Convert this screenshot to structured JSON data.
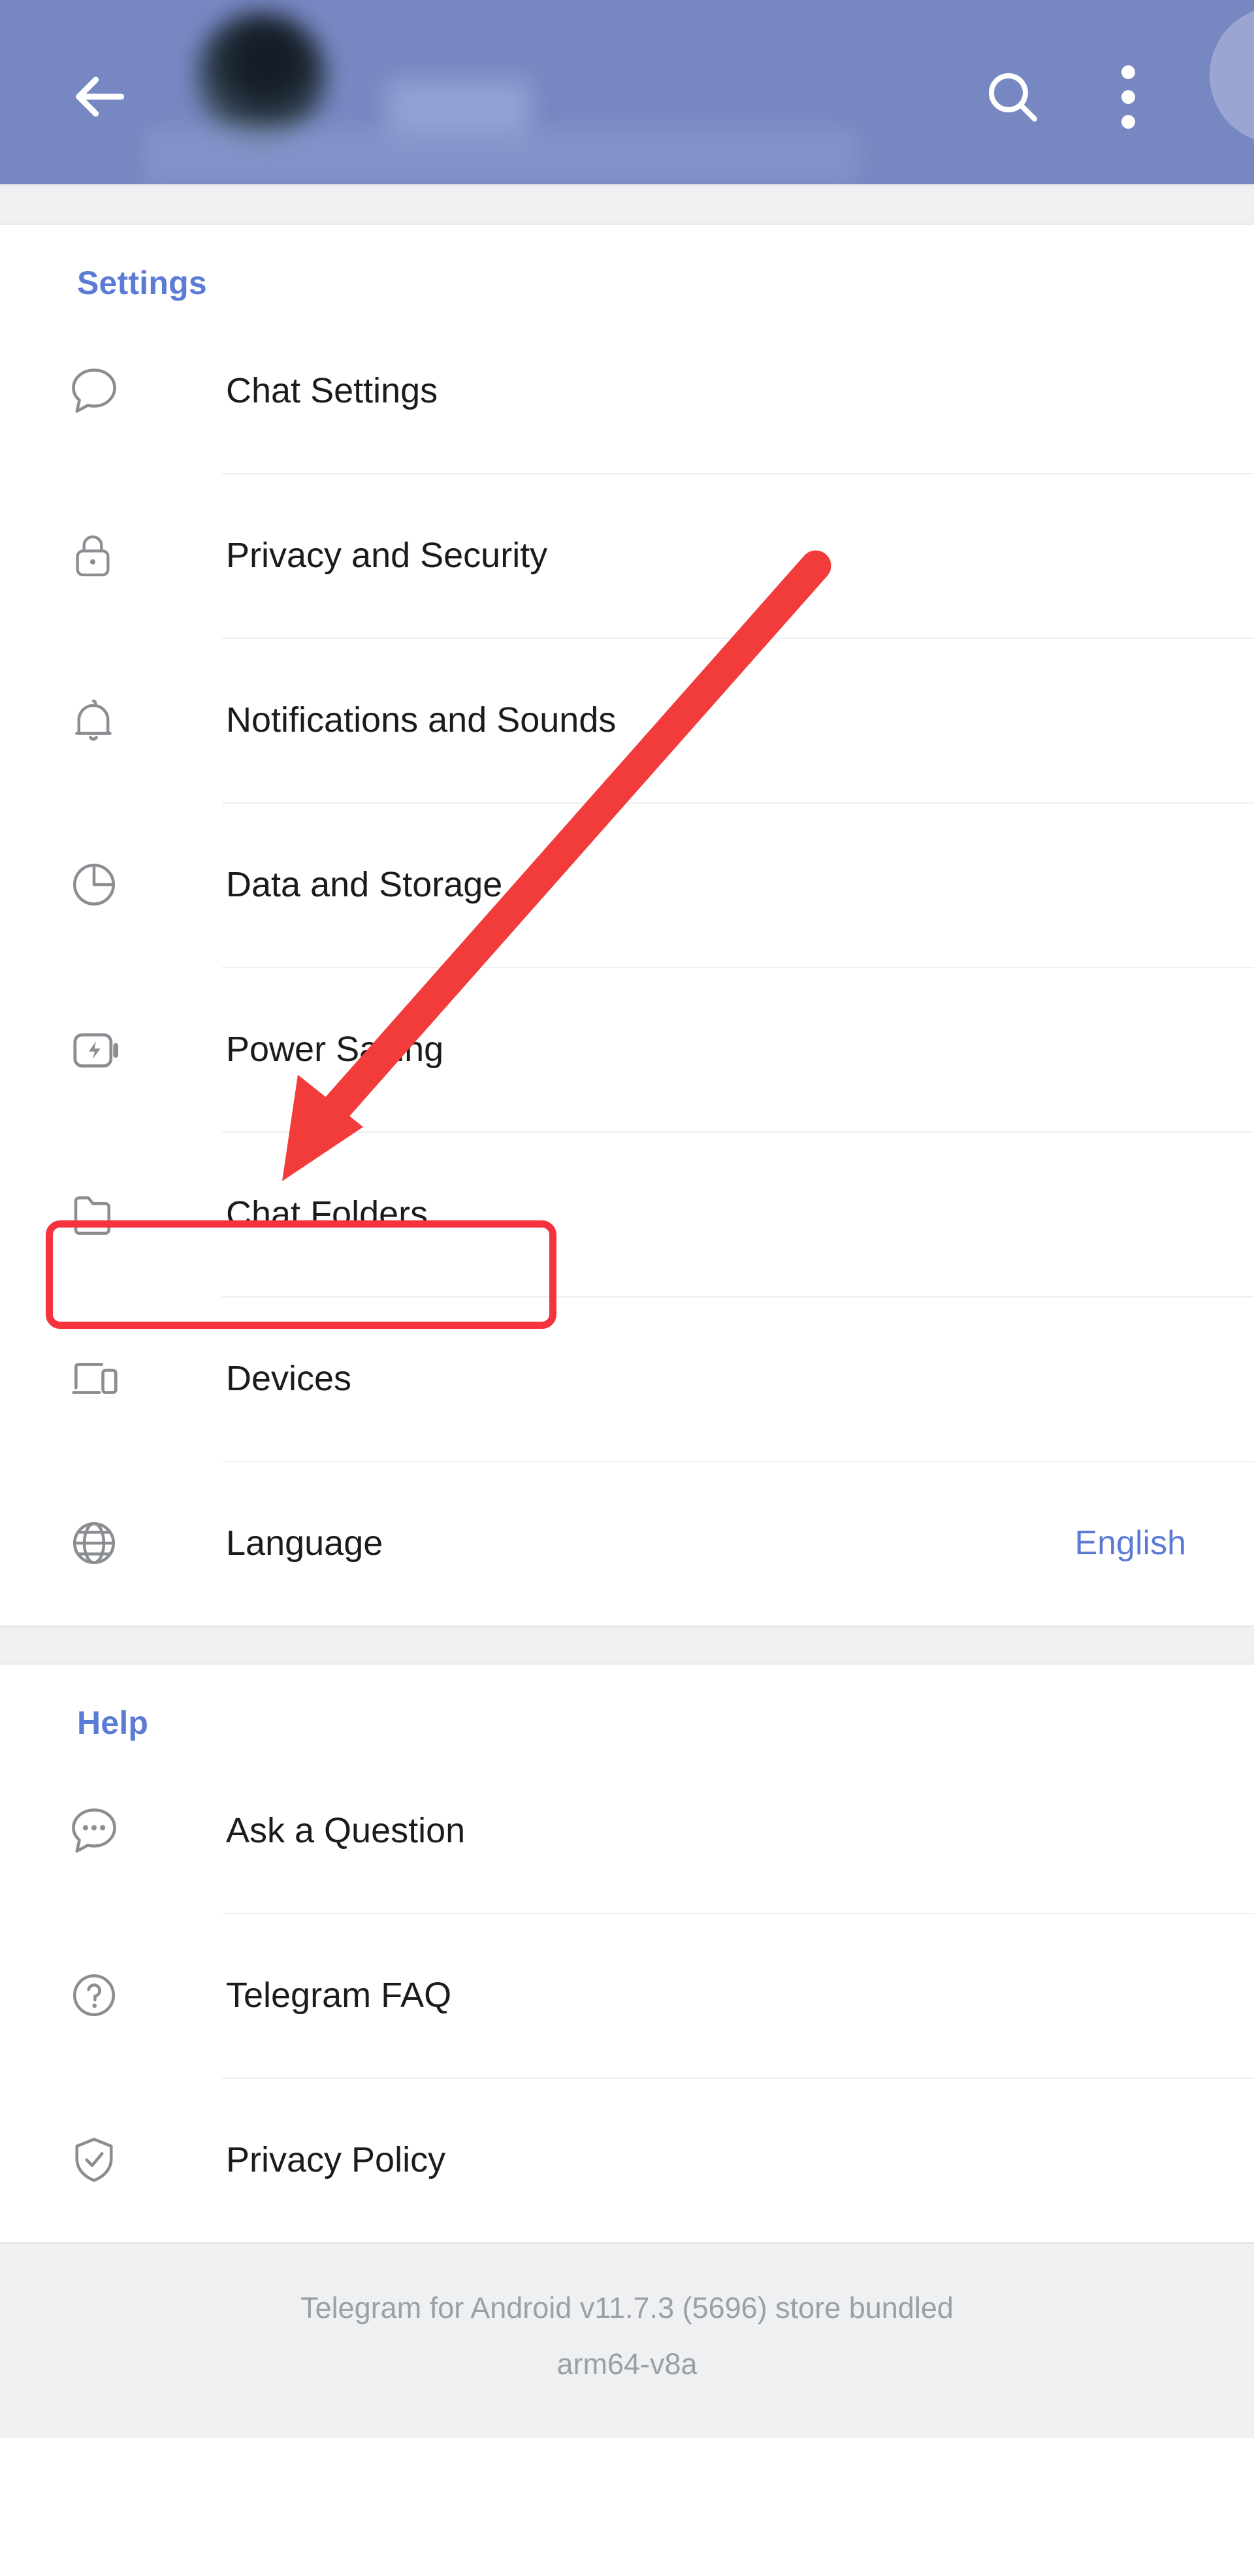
{
  "appbar": {
    "back_icon": "back-arrow-icon",
    "avatar": "profile-avatar-blurred",
    "search_icon": "search-icon",
    "menu_icon": "overflow-menu-icon"
  },
  "sections": [
    {
      "id": "settings",
      "title": "Settings",
      "items": [
        {
          "icon": "chat-bubble-icon",
          "label": "Chat Settings",
          "value": ""
        },
        {
          "icon": "lock-icon",
          "label": "Privacy and Security",
          "value": ""
        },
        {
          "icon": "bell-icon",
          "label": "Notifications and Sounds",
          "value": ""
        },
        {
          "icon": "pie-chart-icon",
          "label": "Data and Storage",
          "value": ""
        },
        {
          "icon": "battery-bolt-icon",
          "label": "Power Saving",
          "value": ""
        },
        {
          "icon": "folder-icon",
          "label": "Chat Folders",
          "value": ""
        },
        {
          "icon": "devices-icon",
          "label": "Devices",
          "value": ""
        },
        {
          "icon": "globe-icon",
          "label": "Language",
          "value": "English"
        }
      ]
    },
    {
      "id": "help",
      "title": "Help",
      "items": [
        {
          "icon": "chat-dots-icon",
          "label": "Ask a Question",
          "value": ""
        },
        {
          "icon": "question-mark-icon",
          "label": "Telegram FAQ",
          "value": ""
        },
        {
          "icon": "shield-check-icon",
          "label": "Privacy Policy",
          "value": ""
        }
      ]
    }
  ],
  "footer": {
    "line1": "Telegram for Android v11.7.3 (5696) store bundled",
    "line2": "arm64-v8a"
  },
  "annotations": {
    "highlight_target": "Chat Folders",
    "highlight_color": "#f5333f",
    "arrow_color": "#f23b3b"
  },
  "colors": {
    "appbar": "#7787c2",
    "accent_blue": "#5b7bd5",
    "band": "#eff0f1",
    "icon_gray": "#8a8d91",
    "text": "#1b1b1b"
  }
}
